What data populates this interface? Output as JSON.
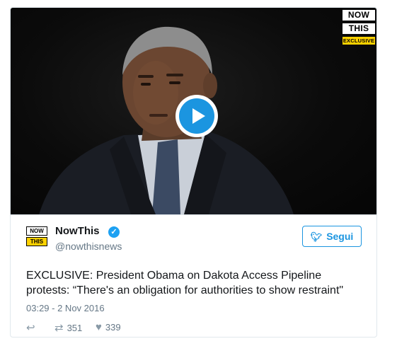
{
  "video": {
    "logo_line1": "NOW",
    "logo_line2": "THIS",
    "logo_badge": "EXCLUSIVE",
    "play_icon": "play-icon"
  },
  "tweet": {
    "avatar_line1": "NOW",
    "avatar_line2": "THIS",
    "name": "NowThis",
    "verified_icon": "verified-badge-icon",
    "handle": "@nowthisnews",
    "follow_label": "Segui",
    "follow_icon": "twitter-bird-icon",
    "text": "EXCLUSIVE: President Obama on Dakota Access Pipeline protests: “There's an obligation for authorities to show restraint\"",
    "timestamp": "03:29 - 2 Nov 2016",
    "reply_icon": "reply-icon",
    "retweet_icon": "retweet-icon",
    "retweet_count": "351",
    "like_icon": "heart-icon",
    "like_count": "339"
  },
  "colors": {
    "accent": "#1b95e0",
    "brand_yellow": "#ffd200",
    "muted": "#657786"
  }
}
